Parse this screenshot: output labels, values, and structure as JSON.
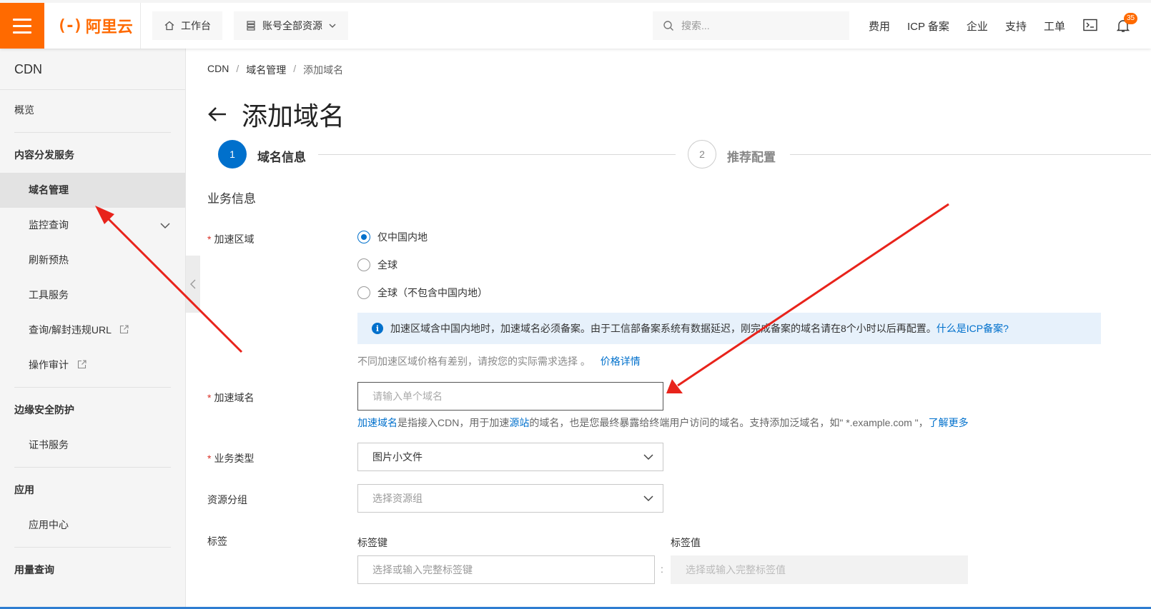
{
  "topbar": {
    "brand_text": "阿里云",
    "brand_mark": "(-)",
    "workbench_label": "工作台",
    "resources_label": "账号全部资源",
    "search_placeholder": "搜索...",
    "nav": [
      "费用",
      "ICP 备案",
      "企业",
      "支持",
      "工单"
    ],
    "notification_count": "35",
    "brand_color": "#ff6a00"
  },
  "sidebar": {
    "title": "CDN",
    "overview": "概览",
    "group_content": "内容分发服务",
    "items_content": [
      {
        "label": "域名管理",
        "active": true
      },
      {
        "label": "监控查询",
        "has_chevron": true
      },
      {
        "label": "刷新预热"
      },
      {
        "label": "工具服务"
      },
      {
        "label": "查询/解封违规URL",
        "external": true
      },
      {
        "label": "操作审计",
        "external": true
      }
    ],
    "group_edge": "边缘安全防护",
    "items_edge": [
      "证书服务"
    ],
    "group_app": "应用",
    "items_app": [
      "应用中心"
    ],
    "group_usage": "用量查询"
  },
  "breadcrumb": [
    "CDN",
    "域名管理",
    "添加域名"
  ],
  "page": {
    "title": "添加域名",
    "steps": [
      {
        "num": "1",
        "label": "域名信息",
        "active": true
      },
      {
        "num": "2",
        "label": "推荐配置",
        "active": false
      }
    ],
    "section_title": "业务信息",
    "accel_region": {
      "label": "加速区域",
      "options": [
        "仅中国内地",
        "全球",
        "全球（不包含中国内地）"
      ],
      "selected": "仅中国内地"
    },
    "info_text": "加速区域含中国内地时，加速域名必须备案。由于工信部备案系统有数据延迟，刚完成备案的域名请在8个小时以后再配置。",
    "info_link": "什么是ICP备案?",
    "price_hint": "不同加速区域价格有差别，请按您的实际需求选择 。",
    "price_link": "价格详情",
    "domain": {
      "label": "加速域名",
      "placeholder": "请输入单个域名",
      "help_link1": "加速域名",
      "help_text1": "是指接入CDN，用于加速",
      "help_link2": "源站",
      "help_text2": "的域名，也是您最终暴露给终端用户访问的域名。支持添加泛域名，如\" *.example.com \"，",
      "help_link3": "了解更多"
    },
    "biz_type": {
      "label": "业务类型",
      "value": "图片小文件"
    },
    "resource_group": {
      "label": "资源分组",
      "placeholder": "选择资源组"
    },
    "tags": {
      "label": "标签",
      "key_label": "标签键",
      "value_label": "标签值",
      "key_placeholder": "选择或输入完整标签键",
      "value_placeholder": "选择或输入完整标签值",
      "separator": ":"
    }
  },
  "colors": {
    "accent": "#0070cc",
    "arrow": "#e8231b",
    "required": "#d93026"
  }
}
